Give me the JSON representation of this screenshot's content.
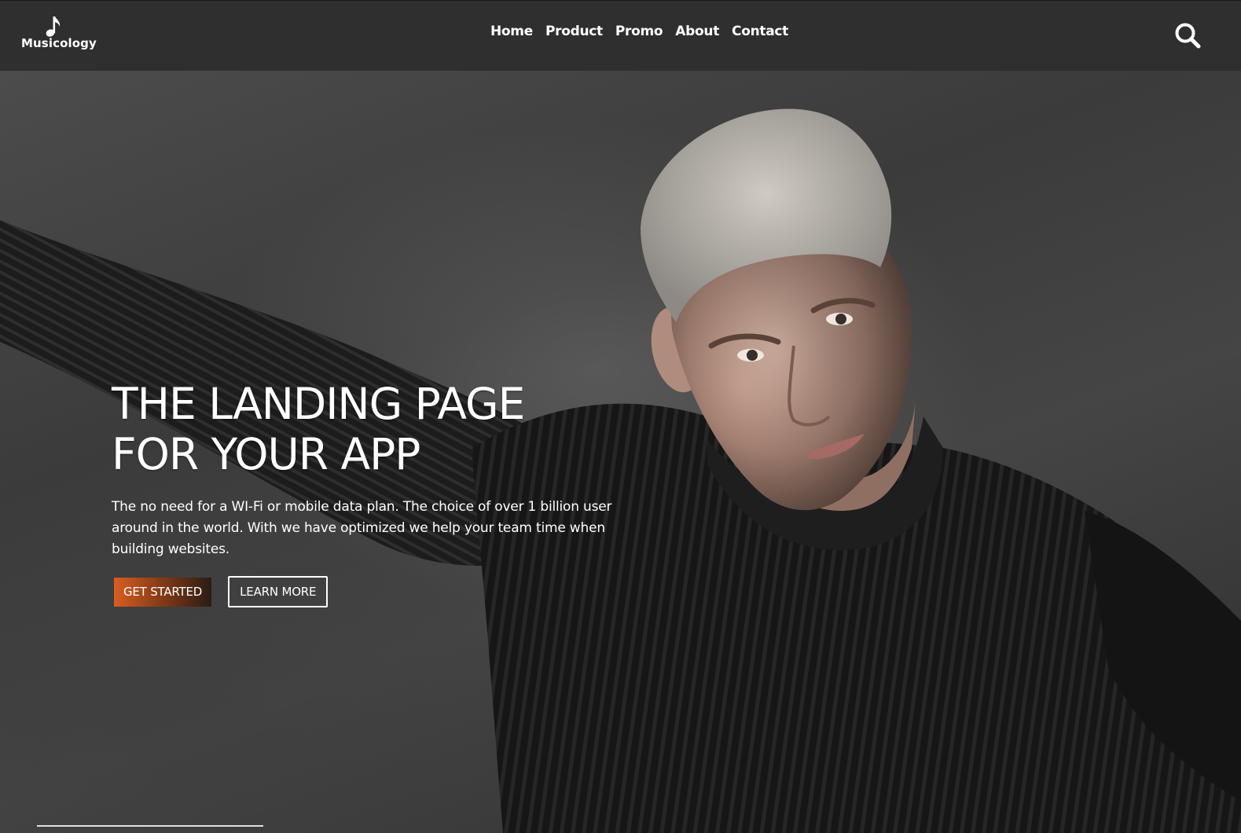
{
  "header": {
    "logo_text": "Musicology",
    "logo_icon": "music-note-icon",
    "nav": [
      {
        "label": "Home"
      },
      {
        "label": "Product"
      },
      {
        "label": "Promo"
      },
      {
        "label": "About"
      },
      {
        "label": "Contact"
      }
    ],
    "search_icon": "search-icon",
    "background_color": "#2f2f2f"
  },
  "hero": {
    "title_line1": "THE LANDING PAGE",
    "title_line2": "FOR YOUR APP",
    "subtitle": "The no need for a WI-Fi or mobile data plan. The choice of over 1 billion user around in the world. With we have optimized we help your team time when building websites.",
    "primary_button": "GET STARTED",
    "secondary_button": "LEARN MORE",
    "accent_color": "#d85e22",
    "background_image": "man in black ribbed turtleneck against grey wall"
  }
}
